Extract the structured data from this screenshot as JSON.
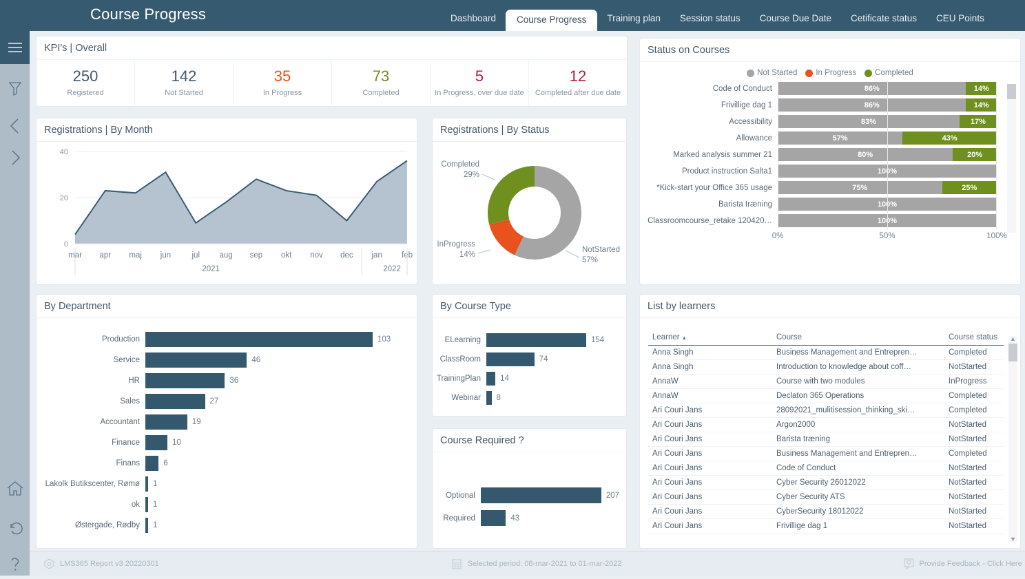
{
  "header": {
    "title": "Course Progress",
    "tabs": [
      {
        "label": "Dashboard",
        "active": false
      },
      {
        "label": "Course Progress",
        "active": true
      },
      {
        "label": "Training plan",
        "active": false
      },
      {
        "label": "Session status",
        "active": false
      },
      {
        "label": "Course Due Date",
        "active": false
      },
      {
        "label": "Cetificate status",
        "active": false
      },
      {
        "label": "CEU Points",
        "active": false
      }
    ]
  },
  "sidebar": {
    "icons": [
      "hamburger-menu-icon",
      "filter-icon",
      "chevron-left-icon",
      "chevron-right-icon",
      "home-icon",
      "undo-icon",
      "help-icon"
    ]
  },
  "kpi": {
    "title": "KPI's | Overall",
    "items": [
      {
        "value": "250",
        "label": "Registered",
        "color": "#44586a"
      },
      {
        "value": "142",
        "label": "Not Started",
        "color": "#44586a"
      },
      {
        "value": "35",
        "label": "In Progress",
        "color": "#e8521f"
      },
      {
        "value": "73",
        "label": "Completed",
        "color": "#6f8f1e"
      },
      {
        "value": "5",
        "label": "In Progress, over due date",
        "color": "#b01f4a"
      },
      {
        "value": "12",
        "label": "Completed after due date",
        "color": "#b01f4a"
      }
    ]
  },
  "panels": {
    "registrations_by_month": "Registrations | By Month",
    "registrations_by_status": "Registrations | By Status",
    "by_department": "By Department",
    "by_course_type": "By Course Type",
    "course_required": "Course Required ?",
    "status_on_courses": "Status on Courses",
    "list_by_learners": "List by learners",
    "expand_icon": "+"
  },
  "learners_table": {
    "columns": [
      "Learner",
      "Course",
      "Course status"
    ],
    "sort_column": "Learner",
    "sort_direction": "asc",
    "rows": [
      [
        "Anna Singh",
        "Business Management and Entrepren…",
        "Completed"
      ],
      [
        "Anna Singh",
        "Introduction to knowledge about coff…",
        "NotStarted"
      ],
      [
        "AnnaW",
        "Course with two modules",
        "InProgress"
      ],
      [
        "AnnaW",
        "Declaton 365 Operations",
        "Completed"
      ],
      [
        "Ari Couri Jans",
        "28092021_mulitisession_thinking_ski…",
        "Completed"
      ],
      [
        "Ari Couri Jans",
        "Argon2000",
        "NotStarted"
      ],
      [
        "Ari Couri Jans",
        "Barista træning",
        "NotStarted"
      ],
      [
        "Ari Couri Jans",
        "Business Management and Entrepren…",
        "Completed"
      ],
      [
        "Ari Couri Jans",
        "Code of Conduct",
        "NotStarted"
      ],
      [
        "Ari Couri Jans",
        "Cyber Security 26012022",
        "NotStarted"
      ],
      [
        "Ari Couri Jans",
        "Cyber Security ATS",
        "NotStarted"
      ],
      [
        "Ari Couri Jans",
        "CyberSecurity 18012022",
        "NotStarted"
      ],
      [
        "Ari Couri Jans",
        "Frivillige dag 1",
        "NotStarted"
      ]
    ]
  },
  "footer": {
    "report": "LMS365 Report v3 20220301",
    "period": "Selected period: 08-mar-2021 to 01-mar-2022",
    "feedback": "Provide Feedback - Click Here"
  },
  "colors": {
    "header_bg": "#365a70",
    "rail_bg": "#adbcc7",
    "page_bg": "#eaeff4",
    "bar_blue": "#34596f",
    "not_started": "#a5a5a5",
    "in_progress": "#e8521f",
    "completed": "#6f8f1e",
    "area_line": "#3b5c72",
    "area_fill": "#aebecb"
  },
  "chart_data": [
    {
      "type": "area",
      "title": "Registrations | By Month",
      "xlabel": "",
      "ylabel": "",
      "ylim": [
        0,
        40
      ],
      "yticks": [
        0,
        20,
        40
      ],
      "grid": true,
      "categories": [
        "mar",
        "apr",
        "maj",
        "jun",
        "jul",
        "aug",
        "sep",
        "okt",
        "nov",
        "dec",
        "jan",
        "feb"
      ],
      "group_labels": [
        {
          "label": "2021",
          "from": "mar",
          "to": "dec"
        },
        {
          "label": "2022",
          "from": "jan",
          "to": "feb"
        }
      ],
      "values": [
        4,
        23,
        22,
        31,
        9,
        18,
        28,
        23,
        21,
        10,
        27,
        36
      ]
    },
    {
      "type": "pie",
      "title": "Registrations | By Status",
      "donut": true,
      "labels": [
        "NotStarted",
        "InProgress",
        "Completed"
      ],
      "values": [
        57,
        14,
        29
      ],
      "value_labels": [
        "57%",
        "14%",
        "29%"
      ],
      "colors": [
        "#a5a5a5",
        "#e8521f",
        "#6f8f1e"
      ]
    },
    {
      "type": "bar",
      "orientation": "horizontal",
      "title": "By Department",
      "categories": [
        "Production",
        "Service",
        "HR",
        "Sales",
        "Accountant",
        "Finance",
        "Finans",
        "Lakolk Butikscenter, Rømø",
        "ok",
        "Østergade, Rødby"
      ],
      "values": [
        103,
        46,
        36,
        27,
        19,
        10,
        6,
        1,
        1,
        1
      ],
      "xlim": [
        0,
        103
      ]
    },
    {
      "type": "bar",
      "orientation": "horizontal",
      "title": "By Course Type",
      "categories": [
        "ELearning",
        "ClassRoom",
        "TrainingPlan",
        "Webinar"
      ],
      "values": [
        154,
        74,
        14,
        8
      ],
      "xlim": [
        0,
        154
      ]
    },
    {
      "type": "bar",
      "orientation": "horizontal",
      "title": "Course Required ?",
      "categories": [
        "Optional",
        "Required"
      ],
      "values": [
        207,
        43
      ],
      "xlim": [
        0,
        207
      ]
    },
    {
      "type": "bar",
      "orientation": "horizontal",
      "stacked": true,
      "title": "Status on Courses",
      "legend": [
        "Not Started",
        "In Progress",
        "Completed"
      ],
      "legend_colors": [
        "#a5a5a5",
        "#e8521f",
        "#6f8f1e"
      ],
      "legend_position": "top",
      "xlabel": "",
      "xlim": [
        0,
        100
      ],
      "xticks": [
        "0%",
        "50%",
        "100%"
      ],
      "categories": [
        "Code of Conduct",
        "Frivillige dag 1",
        "Accessibility",
        "Allowance",
        "Marked analysis summer 21",
        "Product instruction Salta1",
        "*Kick-start your Office 365 usage",
        "Barista træning",
        "Classroomcourse_retake 120420…"
      ],
      "series": [
        {
          "name": "Not Started",
          "values": [
            86,
            86,
            83,
            57,
            80,
            100,
            75,
            100,
            100
          ]
        },
        {
          "name": "In Progress",
          "values": [
            0,
            0,
            0,
            0,
            0,
            0,
            0,
            0,
            0
          ]
        },
        {
          "name": "Completed",
          "values": [
            14,
            14,
            17,
            43,
            20,
            0,
            25,
            0,
            0
          ]
        }
      ]
    }
  ]
}
